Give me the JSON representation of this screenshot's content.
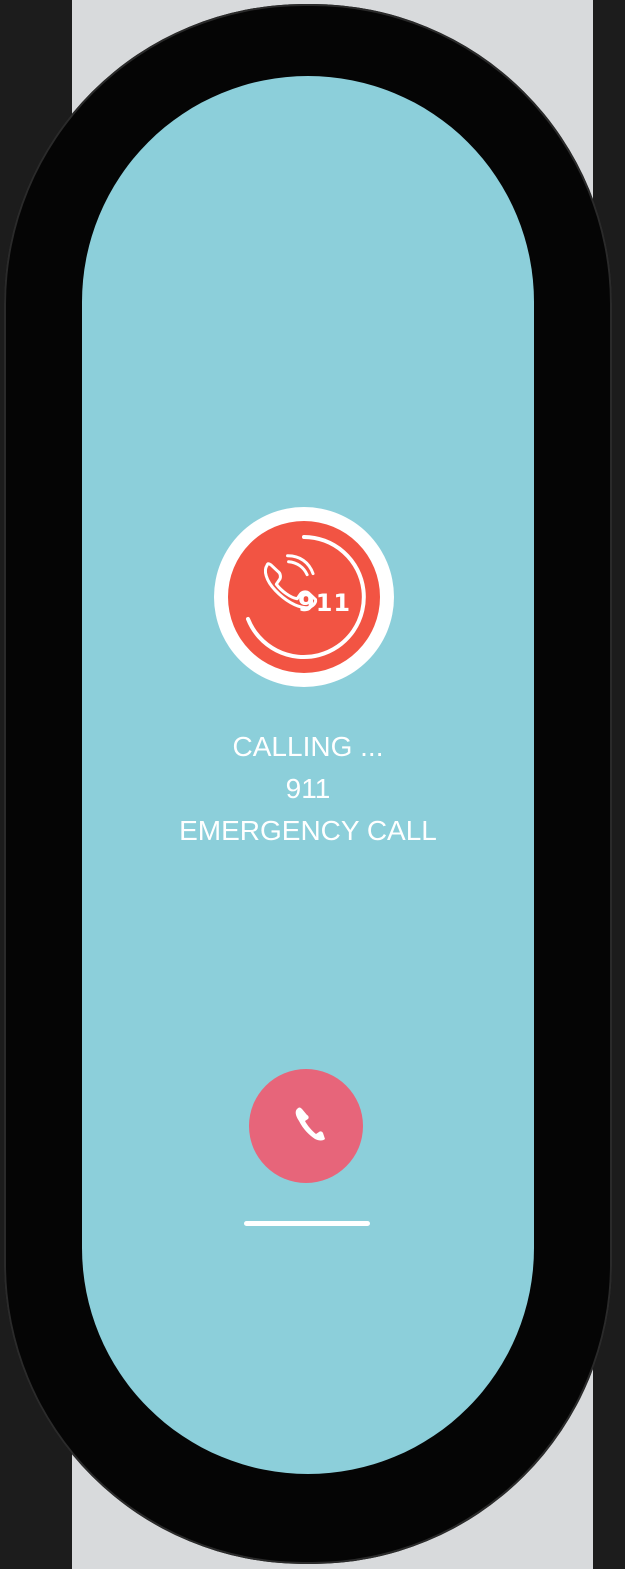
{
  "call": {
    "badge_number": "911",
    "status": "CALLING ...",
    "number": "911",
    "label": "EMERGENCY CALL"
  },
  "icons": {
    "call_badge": "phone-icon",
    "end_call": "phone-hangup-icon"
  },
  "colors": {
    "screen_background": "#8ccfda",
    "call_badge_red": "#f25443",
    "end_call_pink": "#e7657a",
    "text": "#ffffff"
  }
}
